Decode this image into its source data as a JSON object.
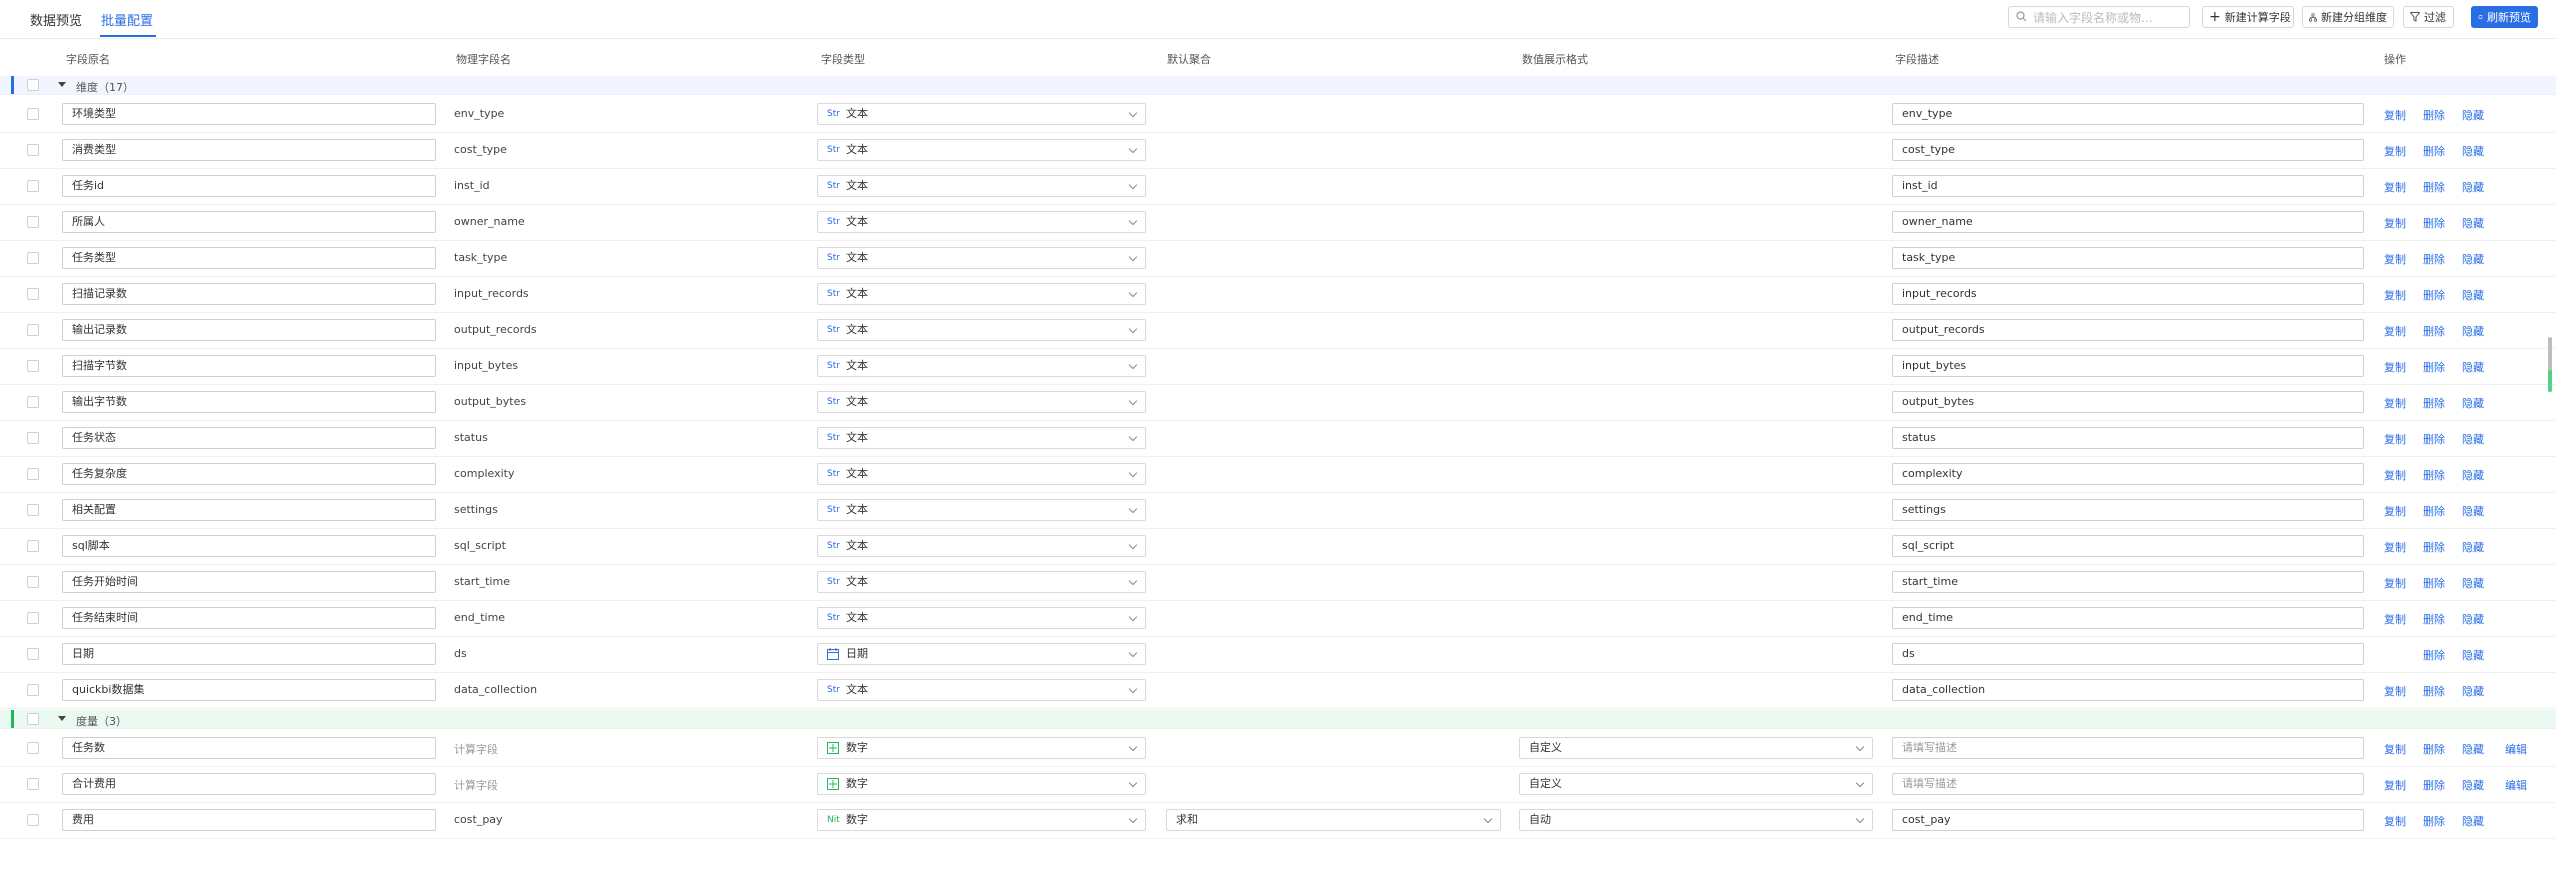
{
  "tabs": [
    {
      "label": "数据预览",
      "active": false
    },
    {
      "label": "批量配置",
      "active": true
    }
  ],
  "toolbar": {
    "search_placeholder": "请输入字段名称或物...",
    "new_calc_field": "新建计算字段",
    "new_group_dim": "新建分组维度",
    "filter": "过滤",
    "refresh_preview": "刷新预览"
  },
  "columns": {
    "field_name": "字段原名",
    "physical_name": "物理字段名",
    "field_type": "字段类型",
    "default_agg": "默认聚合",
    "display_format": "数值展示格式",
    "description": "字段描述",
    "actions": "操作"
  },
  "groups": [
    {
      "name": "维度（17）",
      "accent": "#2a6ee6",
      "bg": "#f0f5ff",
      "rows": [
        {
          "name": "环境类型",
          "physical": "env_type",
          "type_icon": "Str",
          "type": "文本",
          "desc": "env_type",
          "ops": [
            "复制",
            "删除",
            "隐藏"
          ]
        },
        {
          "name": "消费类型",
          "physical": "cost_type",
          "type_icon": "Str",
          "type": "文本",
          "desc": "cost_type",
          "ops": [
            "复制",
            "删除",
            "隐藏"
          ]
        },
        {
          "name": "任务id",
          "physical": "inst_id",
          "type_icon": "Str",
          "type": "文本",
          "desc": "inst_id",
          "ops": [
            "复制",
            "删除",
            "隐藏"
          ]
        },
        {
          "name": "所属人",
          "physical": "owner_name",
          "type_icon": "Str",
          "type": "文本",
          "desc": "owner_name",
          "ops": [
            "复制",
            "删除",
            "隐藏"
          ]
        },
        {
          "name": "任务类型",
          "physical": "task_type",
          "type_icon": "Str",
          "type": "文本",
          "desc": "task_type",
          "ops": [
            "复制",
            "删除",
            "隐藏"
          ]
        },
        {
          "name": "扫描记录数",
          "physical": "input_records",
          "type_icon": "Str",
          "type": "文本",
          "desc": "input_records",
          "ops": [
            "复制",
            "删除",
            "隐藏"
          ]
        },
        {
          "name": "输出记录数",
          "physical": "output_records",
          "type_icon": "Str",
          "type": "文本",
          "desc": "output_records",
          "ops": [
            "复制",
            "删除",
            "隐藏"
          ]
        },
        {
          "name": "扫描字节数",
          "physical": "input_bytes",
          "type_icon": "Str",
          "type": "文本",
          "desc": "input_bytes",
          "ops": [
            "复制",
            "删除",
            "隐藏"
          ]
        },
        {
          "name": "输出字节数",
          "physical": "output_bytes",
          "type_icon": "Str",
          "type": "文本",
          "desc": "output_bytes",
          "ops": [
            "复制",
            "删除",
            "隐藏"
          ]
        },
        {
          "name": "任务状态",
          "physical": "status",
          "type_icon": "Str",
          "type": "文本",
          "desc": "status",
          "ops": [
            "复制",
            "删除",
            "隐藏"
          ]
        },
        {
          "name": "任务复杂度",
          "physical": "complexity",
          "type_icon": "Str",
          "type": "文本",
          "desc": "complexity",
          "ops": [
            "复制",
            "删除",
            "隐藏"
          ]
        },
        {
          "name": "相关配置",
          "physical": "settings",
          "type_icon": "Str",
          "type": "文本",
          "desc": "settings",
          "ops": [
            "复制",
            "删除",
            "隐藏"
          ]
        },
        {
          "name": "sql脚本",
          "physical": "sql_script",
          "type_icon": "Str",
          "type": "文本",
          "desc": "sql_script",
          "ops": [
            "复制",
            "删除",
            "隐藏"
          ]
        },
        {
          "name": "任务开始时间",
          "physical": "start_time",
          "type_icon": "Str",
          "type": "文本",
          "desc": "start_time",
          "ops": [
            "复制",
            "删除",
            "隐藏"
          ]
        },
        {
          "name": "任务结束时间",
          "physical": "end_time",
          "type_icon": "Str",
          "type": "文本",
          "desc": "end_time",
          "ops": [
            "复制",
            "删除",
            "隐藏"
          ]
        },
        {
          "name": "日期",
          "physical": "ds",
          "type_icon": "calendar",
          "type": "日期",
          "desc": "ds",
          "ops": [
            "",
            "删除",
            "隐藏"
          ]
        },
        {
          "name": "quickbi数据集",
          "physical": "data_collection",
          "type_icon": "Str",
          "type": "文本",
          "desc": "data_collection",
          "ops": [
            "复制",
            "删除",
            "隐藏"
          ]
        }
      ]
    },
    {
      "name": "度量（3）",
      "accent": "#1fb85a",
      "bg": "#eafaf0",
      "rows": [
        {
          "name": "任务数",
          "physical": "计算字段",
          "physical_calc": true,
          "type_icon": "calc",
          "type": "数字",
          "format": "自定义",
          "desc": "请填写描述",
          "desc_placeholder": true,
          "ops": [
            "复制",
            "删除",
            "隐藏",
            "编辑"
          ]
        },
        {
          "name": "合计费用",
          "physical": "计算字段",
          "physical_calc": true,
          "type_icon": "calc",
          "type": "数字",
          "format": "自定义",
          "desc": "请填写描述",
          "desc_placeholder": true,
          "ops": [
            "复制",
            "删除",
            "隐藏",
            "编辑"
          ]
        },
        {
          "name": "费用",
          "physical": "cost_pay",
          "type_icon": "Nit",
          "type": "数字",
          "agg": "求和",
          "format": "自动",
          "desc": "cost_pay",
          "ops": [
            "复制",
            "删除",
            "隐藏"
          ]
        }
      ]
    }
  ]
}
